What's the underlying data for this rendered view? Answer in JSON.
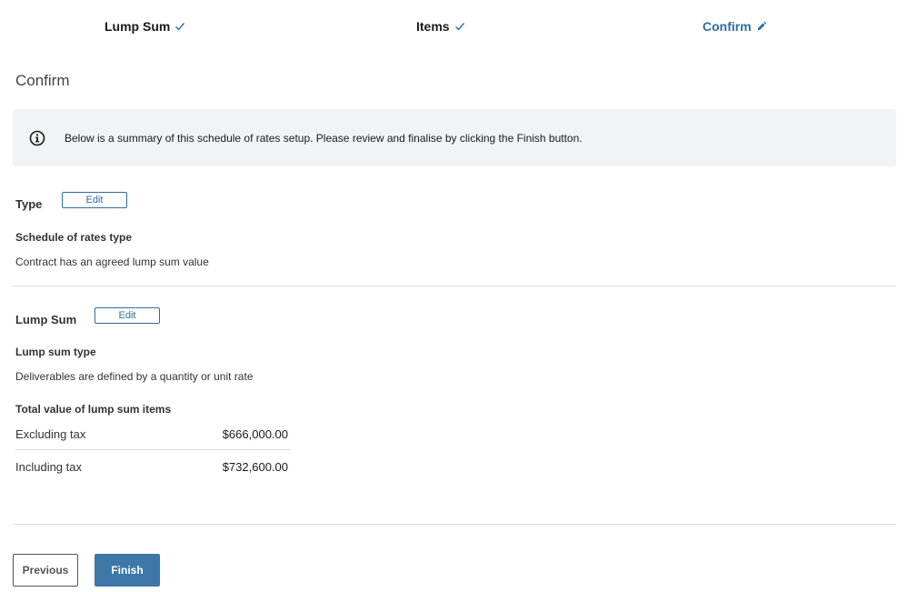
{
  "stepper": {
    "steps": [
      {
        "label": "Lump Sum",
        "status": "complete",
        "icon": "check-icon"
      },
      {
        "label": "Items",
        "status": "complete",
        "icon": "check-icon"
      },
      {
        "label": "Confirm",
        "status": "active",
        "icon": "pencil-icon"
      }
    ]
  },
  "page_title": "Confirm",
  "info": {
    "icon": "info-circle-icon",
    "text": "Below is a summary of this schedule of rates setup. Please review and finalise by clicking the Finish button."
  },
  "type_section": {
    "title": "Type",
    "edit_label": "Edit",
    "field_label": "Schedule of rates type",
    "field_value": "Contract has an agreed lump sum value"
  },
  "lump_sum_section": {
    "title": "Lump Sum",
    "edit_label": "Edit",
    "type_label": "Lump sum type",
    "type_value": "Deliverables are defined by a quantity or unit rate",
    "total_label": "Total value of lump sum items",
    "totals": [
      {
        "label": "Excluding tax",
        "value": "$666,000.00"
      },
      {
        "label": "Including tax",
        "value": "$732,600.00"
      }
    ]
  },
  "footer": {
    "previous_label": "Previous",
    "finish_label": "Finish"
  },
  "colors": {
    "accent": "#2e6da4",
    "primary_button": "#3e77a8",
    "info_background": "#f2f3f4"
  }
}
